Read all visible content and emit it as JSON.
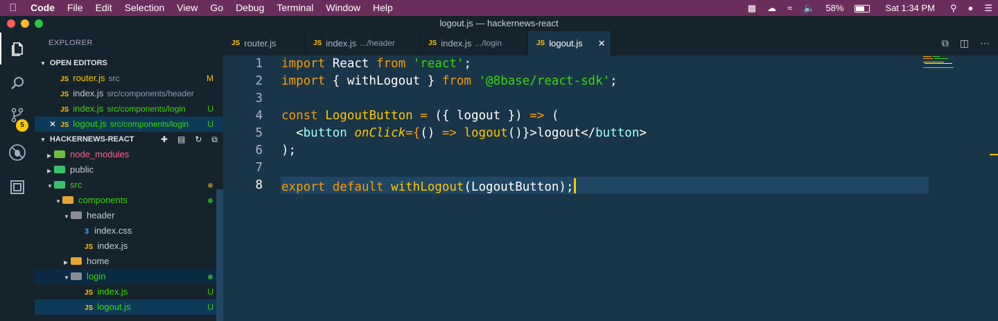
{
  "menubar": {
    "app": "Code",
    "items": [
      "File",
      "Edit",
      "Selection",
      "View",
      "Go",
      "Debug",
      "Terminal",
      "Window",
      "Help"
    ],
    "battery": "58%",
    "clock": "Sat 1:34 PM"
  },
  "window": {
    "title": "logout.js — hackernews-react"
  },
  "activity": {
    "badge": "5"
  },
  "sidebar": {
    "title": "EXPLORER",
    "open_editors": {
      "label": "OPEN EDITORS",
      "items": [
        {
          "name": "router.js",
          "path": "src",
          "status": "M"
        },
        {
          "name": "index.js",
          "path": "src/components/header",
          "status": ""
        },
        {
          "name": "index.js",
          "path": "src/components/login",
          "status": "U"
        },
        {
          "name": "logout.js",
          "path": "src/components/login",
          "status": "U"
        }
      ]
    },
    "project": {
      "label": "HACKERNEWS-REACT",
      "items": [
        "node_modules",
        "public",
        "src",
        "components",
        "header",
        "index.css",
        "index.js",
        "home",
        "login",
        "index.js",
        "logout.js"
      ],
      "statuses": {
        "login_index": "U",
        "logout": "U"
      }
    }
  },
  "tabs": [
    {
      "label": "router.js",
      "desc": ""
    },
    {
      "label": "index.js",
      "desc": ".../header"
    },
    {
      "label": "index.js",
      "desc": ".../login"
    },
    {
      "label": "logout.js",
      "desc": ""
    }
  ],
  "editor": {
    "line_numbers": [
      "1",
      "2",
      "3",
      "4",
      "5",
      "6",
      "7",
      "8"
    ],
    "code": {
      "l1": {
        "k": "import",
        "id": " React ",
        "from": "from",
        "s": "'react'",
        "end": ";"
      },
      "l2": {
        "k": "import",
        "open": " { ",
        "id": "withLogout",
        "close": " } ",
        "from": "from",
        "s": "'@8base/react-sdk'",
        "end": ";"
      },
      "l4": {
        "k": "const",
        "name": "LogoutButton",
        "rest1": " = ",
        "paren": "({ ",
        "arg": "logout",
        "paren2": " })",
        "arrow": " =>",
        "open": " ("
      },
      "l5": {
        "lt": "<",
        "tag": "button",
        "attr": "onClick",
        "eq": "={",
        "fn1": "()",
        "arrow": " =>",
        "call": " logout",
        "paren": "()",
        "gt": "}>",
        "text": "logout",
        "close": "</",
        "tag2": "button",
        "gt2": ">"
      },
      "l6": {
        "t": ");"
      },
      "l8": {
        "k1": "export",
        "k2": "default",
        "fn": "withLogout",
        "open": "(",
        "arg": "LogoutButton",
        "close": ");"
      }
    }
  },
  "colors": {
    "accent": "#ffc600",
    "bg": "#193549",
    "sidebar": "#15232d",
    "menubar": "#6a2e5c"
  }
}
